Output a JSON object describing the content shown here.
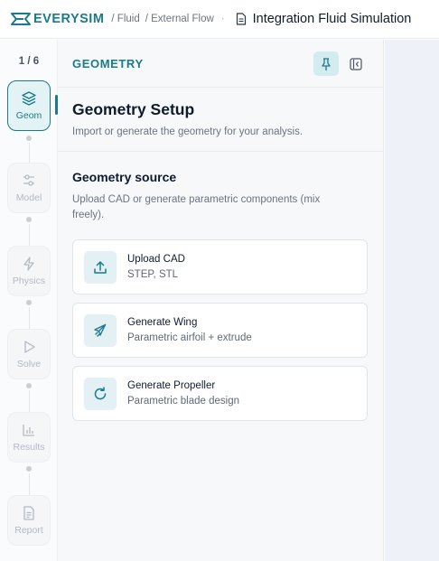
{
  "colors": {
    "accent": "#1b7a8c",
    "accent_bg": "#e3f3f5",
    "panel_bg": "#f7f8fa"
  },
  "header": {
    "logo_text": "EVERYSIM",
    "breadcrumb": [
      "/ Fluid",
      "/ External Flow"
    ],
    "separator": "·",
    "document_icon": "document-icon",
    "title": "Integration Fluid Simulation"
  },
  "rail": {
    "step_count": "1 / 6",
    "steps": [
      {
        "label": "Geom",
        "icon": "layers-icon",
        "state": "active"
      },
      {
        "label": "Model",
        "icon": "sliders-icon",
        "state": "inactive"
      },
      {
        "label": "Physics",
        "icon": "lightning-icon",
        "state": "inactive"
      },
      {
        "label": "Solve",
        "icon": "play-icon",
        "state": "inactive"
      },
      {
        "label": "Results",
        "icon": "bar-chart-icon",
        "state": "inactive"
      },
      {
        "label": "Report",
        "icon": "report-icon",
        "state": "inactive"
      }
    ]
  },
  "panel": {
    "header_title": "GEOMETRY",
    "pin_icon": "pin-icon",
    "collapse_icon": "collapse-panel-icon",
    "setup_title": "Geometry Setup",
    "setup_subtitle": "Import or generate the geometry for your analysis.",
    "source_title": "Geometry source",
    "source_subtitle": "Upload CAD or generate parametric components (mix freely).",
    "options": [
      {
        "title": "Upload CAD",
        "subtitle": "STEP, STL",
        "icon": "upload-icon"
      },
      {
        "title": "Generate Wing",
        "subtitle": "Parametric airfoil + extrude",
        "icon": "plane-icon"
      },
      {
        "title": "Generate Propeller",
        "subtitle": "Parametric blade design",
        "icon": "rotate-icon"
      }
    ]
  }
}
